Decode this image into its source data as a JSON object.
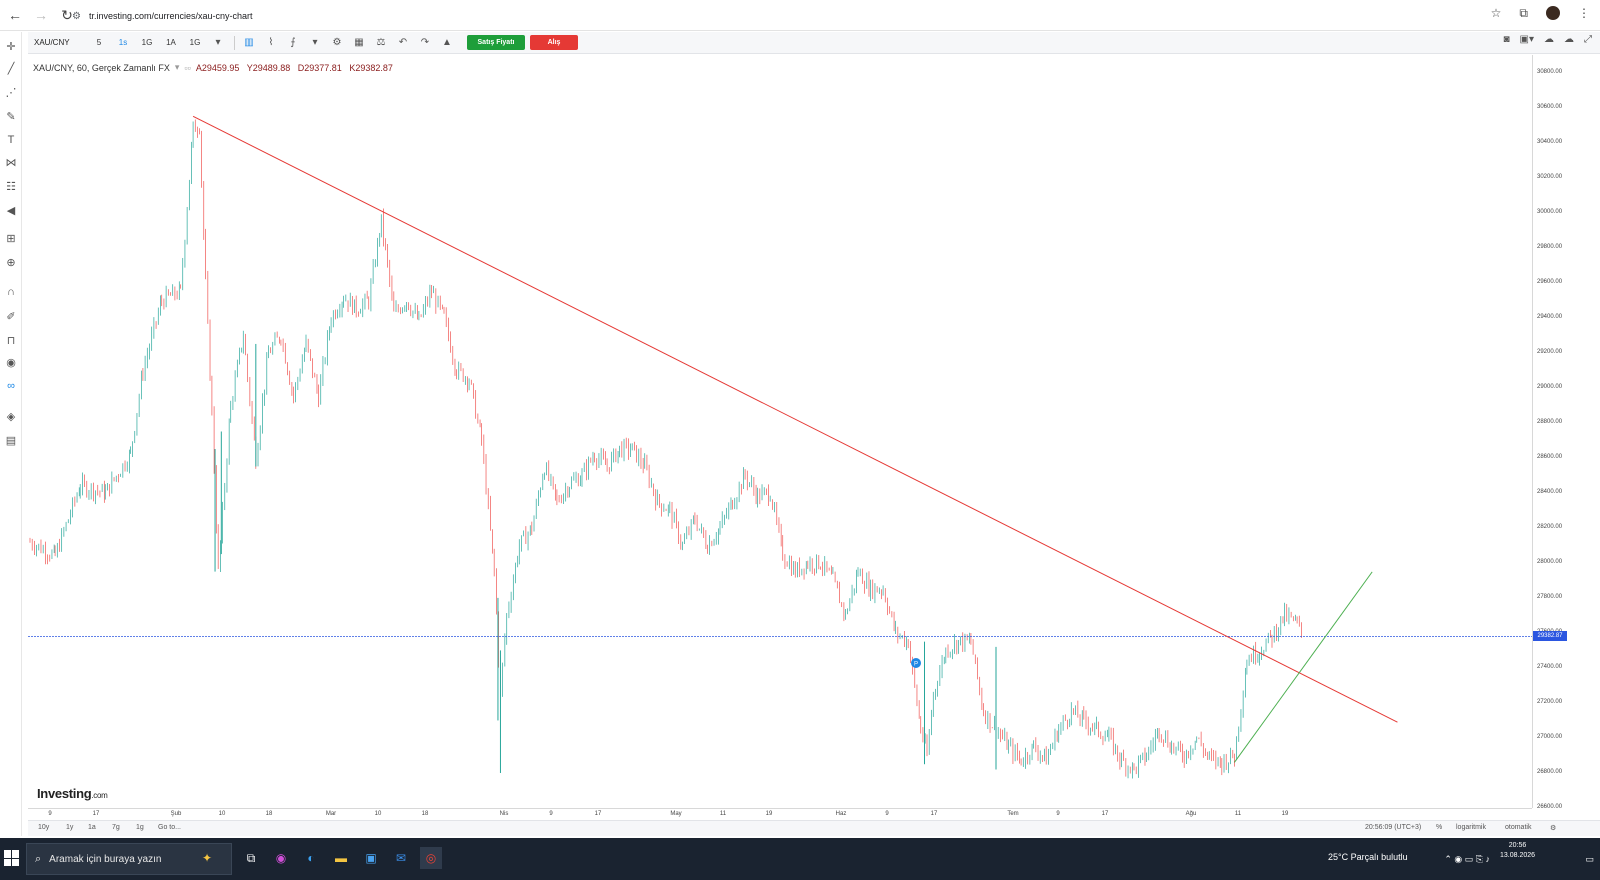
{
  "browser": {
    "url": "tr.investing.com/currencies/xau-cny-chart"
  },
  "toolbar": {
    "symbol": "XAU/CNY",
    "intervals": [
      "5",
      "1s",
      "1G",
      "1A",
      "1G"
    ],
    "active_interval_index": 1,
    "sell_label": "Satış Fiyatı",
    "buy_label": "Alış"
  },
  "legend": {
    "title": "XAU/CNY, 60, Gerçek Zamanlı FX",
    "open": "A29459.95",
    "high": "Y29489.88",
    "low": "D29377.81",
    "close": "K29382.87"
  },
  "colors": {
    "up": "#26a69a",
    "down": "#ef5350",
    "trendline_down": "#e53935",
    "trendline_up": "#4caf50",
    "price_line": "#2b56e0"
  },
  "chart_data": {
    "type": "candlestick",
    "ylim": [
      26600,
      30900
    ],
    "yticks": [
      "30800.00",
      "30600.00",
      "30400.00",
      "30200.00",
      "30000.00",
      "29800.00",
      "29600.00",
      "29400.00",
      "29200.00",
      "29000.00",
      "28800.00",
      "28600.00",
      "28400.00",
      "28200.00",
      "28000.00",
      "27800.00",
      "27600.00",
      "27400.00",
      "27200.00",
      "27000.00",
      "26800.00",
      "26600.00"
    ],
    "xticks": [
      "9",
      "17",
      "Şub",
      "10",
      "18",
      "Mar",
      "10",
      "18",
      "Nis",
      "9",
      "17",
      "May",
      "11",
      "19",
      "Haz",
      "9",
      "17",
      "Tem",
      "9",
      "17",
      "Ağu",
      "11",
      "19"
    ],
    "current_price": "29382.87",
    "current_price_value": 27580,
    "price_path": [
      [
        0,
        28120
      ],
      [
        4,
        28040
      ],
      [
        8,
        28440
      ],
      [
        12,
        28400
      ],
      [
        16,
        28620
      ],
      [
        18,
        29100
      ],
      [
        21,
        29500
      ],
      [
        24,
        29550
      ],
      [
        26,
        30480
      ],
      [
        27,
        30500
      ],
      [
        28,
        29600
      ],
      [
        29,
        28860
      ],
      [
        30,
        27950
      ],
      [
        32,
        28900
      ],
      [
        34,
        29300
      ],
      [
        36,
        28600
      ],
      [
        38,
        29200
      ],
      [
        40,
        29300
      ],
      [
        42,
        28950
      ],
      [
        44,
        29250
      ],
      [
        46,
        28950
      ],
      [
        48,
        29400
      ],
      [
        50,
        29520
      ],
      [
        52,
        29450
      ],
      [
        54,
        29500
      ],
      [
        56,
        29950
      ],
      [
        57,
        29700
      ],
      [
        58,
        29420
      ],
      [
        60,
        29500
      ],
      [
        62,
        29380
      ],
      [
        64,
        29550
      ],
      [
        66,
        29400
      ],
      [
        68,
        29100
      ],
      [
        70,
        29050
      ],
      [
        72,
        28700
      ],
      [
        74,
        27950
      ],
      [
        75,
        27250
      ],
      [
        76,
        27700
      ],
      [
        78,
        28100
      ],
      [
        80,
        28200
      ],
      [
        82,
        28550
      ],
      [
        84,
        28350
      ],
      [
        86,
        28450
      ],
      [
        88,
        28500
      ],
      [
        90,
        28620
      ],
      [
        92,
        28550
      ],
      [
        94,
        28650
      ],
      [
        96,
        28650
      ],
      [
        98,
        28550
      ],
      [
        100,
        28350
      ],
      [
        102,
        28300
      ],
      [
        104,
        28100
      ],
      [
        106,
        28250
      ],
      [
        108,
        28100
      ],
      [
        110,
        28200
      ],
      [
        112,
        28350
      ],
      [
        114,
        28500
      ],
      [
        116,
        28380
      ],
      [
        118,
        28400
      ],
      [
        120,
        28050
      ],
      [
        122,
        27950
      ],
      [
        124,
        28000
      ],
      [
        126,
        28000
      ],
      [
        128,
        27900
      ],
      [
        130,
        27700
      ],
      [
        132,
        27950
      ],
      [
        134,
        27850
      ],
      [
        136,
        27850
      ],
      [
        138,
        27600
      ],
      [
        140,
        27550
      ],
      [
        142,
        27050
      ],
      [
        143,
        26900
      ],
      [
        144,
        27250
      ],
      [
        146,
        27500
      ],
      [
        148,
        27550
      ],
      [
        150,
        27550
      ],
      [
        152,
        27150
      ],
      [
        154,
        27050
      ],
      [
        156,
        26950
      ],
      [
        158,
        26870
      ],
      [
        160,
        26950
      ],
      [
        162,
        26880
      ],
      [
        164,
        27050
      ],
      [
        166,
        27150
      ],
      [
        168,
        27100
      ],
      [
        170,
        27050
      ],
      [
        172,
        27000
      ],
      [
        174,
        26870
      ],
      [
        176,
        26820
      ],
      [
        178,
        26900
      ],
      [
        180,
        27050
      ],
      [
        182,
        26950
      ],
      [
        184,
        26900
      ],
      [
        186,
        27000
      ],
      [
        188,
        26880
      ],
      [
        190,
        26860
      ],
      [
        192,
        26900
      ],
      [
        194,
        27450
      ],
      [
        196,
        27500
      ],
      [
        198,
        27580
      ],
      [
        200,
        27700
      ],
      [
        202,
        27650
      ],
      [
        203,
        27580
      ]
    ],
    "trendline_down": [
      [
        26,
        30550
      ],
      [
        218,
        27090
      ]
    ],
    "trendline_up": [
      [
        192,
        26860
      ],
      [
        206,
        27720
      ]
    ],
    "annotation": "P"
  },
  "bottom": {
    "ranges": [
      "10y",
      "1y",
      "1a",
      "7g",
      "1g",
      "Go to..."
    ],
    "time": "20:56:09 (UTC+3)",
    "percent": "%",
    "log": "logaritmik",
    "auto": "otomatik"
  },
  "brand": {
    "name": "Investing",
    "suffix": ".com"
  },
  "taskbar": {
    "search_placeholder": "Aramak için buraya yazın",
    "weather": "25°C  Parçalı bulutlu",
    "time": "20:56",
    "date": "13.08.2026"
  }
}
